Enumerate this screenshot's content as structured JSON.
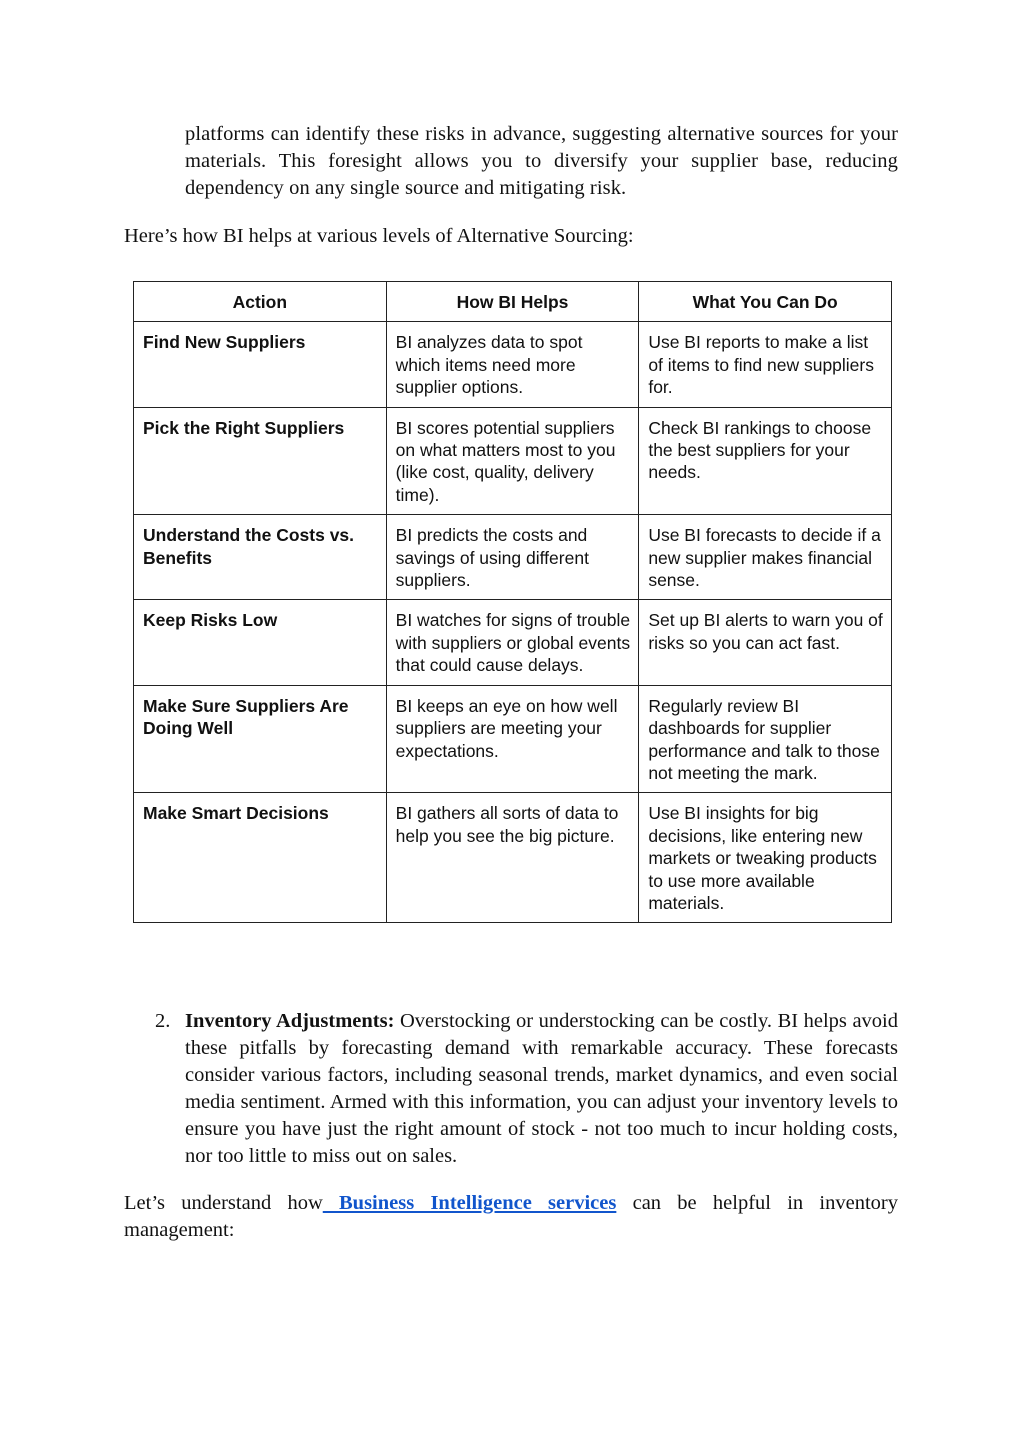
{
  "continuation_paragraph": "platforms can identify these risks in advance, suggesting alternative sources for your materials. This foresight allows you to diversify your supplier base, reducing dependency on any single source and mitigating risk.",
  "intro_sentence": "Here’s how BI helps at various levels of Alternative Sourcing:",
  "table": {
    "headers": [
      "Action",
      "How BI Helps",
      "What You Can Do"
    ],
    "rows": [
      {
        "action": "Find New Suppliers",
        "how": "BI analyzes data to spot which items need more supplier options.",
        "what": "Use BI reports to make a list of items to find new suppliers for."
      },
      {
        "action": "Pick the Right Suppliers",
        "how": "BI scores potential suppliers on what matters most to you (like cost, quality, delivery time).",
        "what": "Check BI rankings to choose the best suppliers for your needs."
      },
      {
        "action": "Understand the Costs vs. Benefits",
        "how": "BI predicts the costs and savings of using different suppliers.",
        "what": "Use BI forecasts to decide if a new supplier makes financial sense."
      },
      {
        "action": "Keep Risks Low",
        "how": "BI watches for signs of trouble with suppliers or global events that could cause delays.",
        "what": "Set up BI alerts to warn you of risks so you can act fast."
      },
      {
        "action": "Make Sure Suppliers Are Doing Well",
        "how": "BI keeps an eye on how well suppliers are meeting your expectations.",
        "what": "Regularly review BI dashboards for supplier performance and talk to those not meeting the mark."
      },
      {
        "action": "Make Smart Decisions",
        "how": "BI gathers all sorts of data to help you see the big picture.",
        "what": "Use BI insights for big decisions, like entering new markets or tweaking products to use more available materials."
      }
    ]
  },
  "list_item": {
    "number": "2.",
    "title": "Inventory Adjustments:",
    "body": " Overstocking or understocking can be costly. BI helps avoid these pitfalls by forecasting demand with remarkable accuracy. These forecasts consider various factors, including seasonal trends, market dynamics, and even social media sentiment. Armed with this information, you can adjust your inventory levels to ensure you have just the right amount of stock - not too much to incur holding costs, nor too little to miss out on sales."
  },
  "closing": {
    "before_link": "Let’s understand how",
    "link_text": " Business Intelligence services",
    "after_link": " can be helpful in inventory management:"
  },
  "colors": {
    "link": "#1155cc",
    "table_border": "#222222"
  }
}
